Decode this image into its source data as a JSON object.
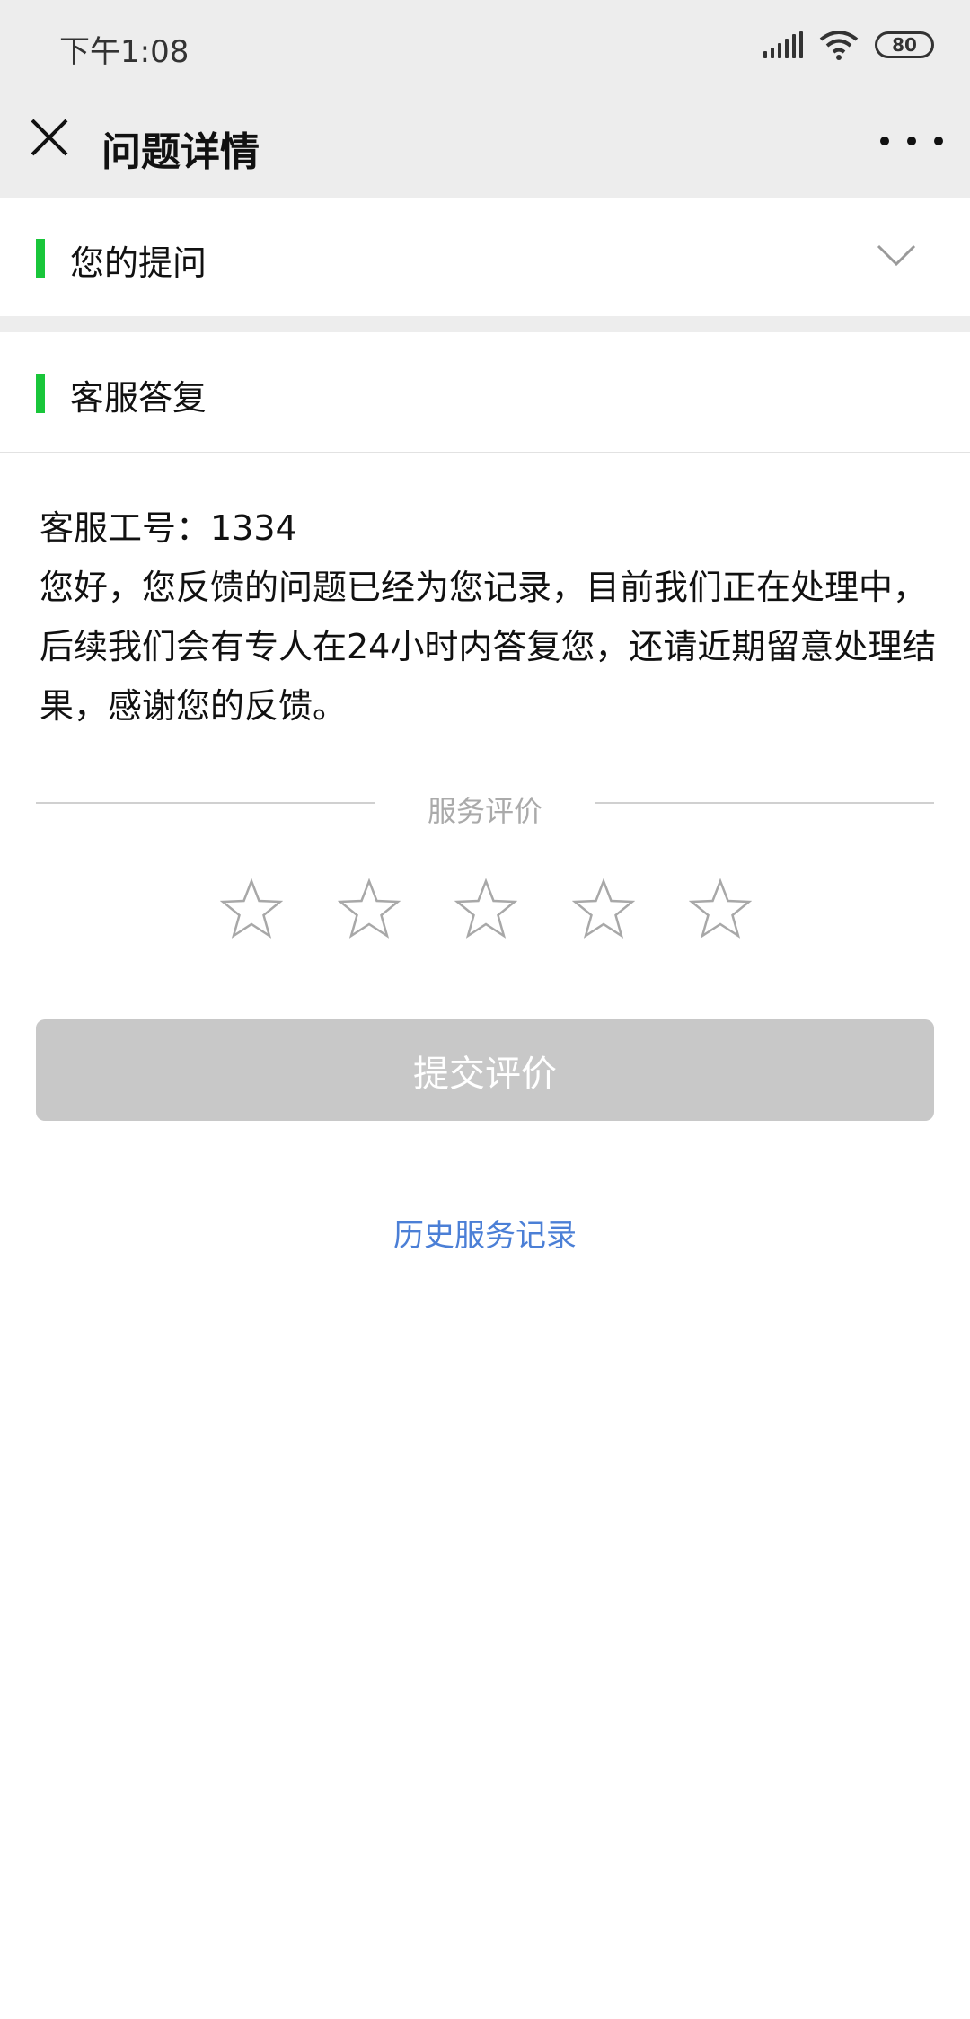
{
  "status_bar": {
    "time": "下午1:08",
    "battery": "80"
  },
  "nav": {
    "title": "问题详情"
  },
  "sections": {
    "question": {
      "title": "您的提问"
    },
    "reply": {
      "title": "客服答复"
    }
  },
  "reply": {
    "staff_id": "客服工号：1334",
    "message": "您好，您反馈的问题已经为您记录，目前我们正在处理中，后续我们会有专人在24小时内答复您，还请近期留意处理结果，感谢您的反馈。"
  },
  "rating": {
    "label": "服务评价",
    "stars_total": 5,
    "stars_selected": 0
  },
  "submit_button": "提交评价",
  "history_link": "历史服务记录"
}
